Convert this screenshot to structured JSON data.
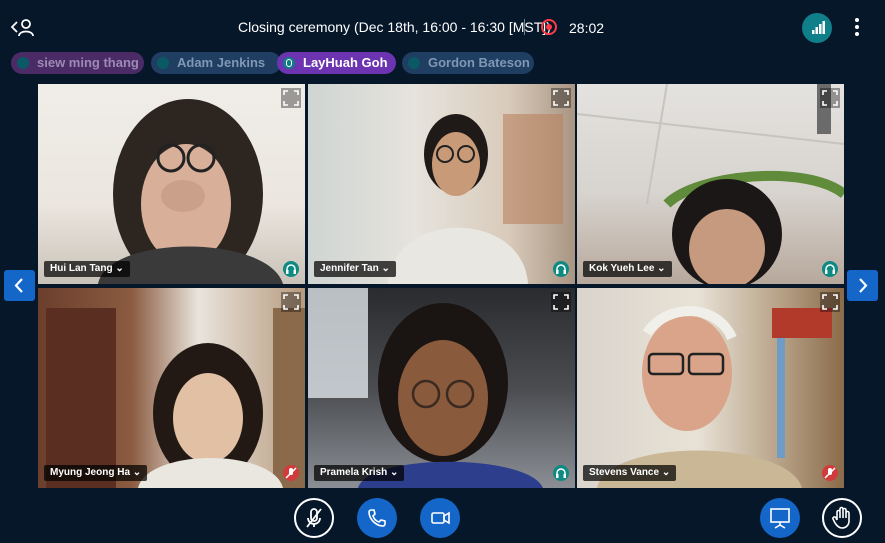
{
  "meeting": {
    "title": "Closing ceremony (Dec 18th, 16:00 - 16:30 [MST])",
    "recording_time": "28:02"
  },
  "participants_bar": [
    {
      "name": "siew ming thang"
    },
    {
      "name": "Adam Jenkins"
    },
    {
      "name": "LayHuah Goh"
    },
    {
      "name": "Gordon Bateson"
    }
  ],
  "video_tiles": [
    {
      "name": "Hui Lan Tang",
      "audio": "listen-only"
    },
    {
      "name": "Jennifer Tan",
      "audio": "listen-only"
    },
    {
      "name": "Kok Yueh Lee",
      "audio": "listen-only"
    },
    {
      "name": "Myung Jeong Ha",
      "audio": "muted"
    },
    {
      "name": "Pramela Krish",
      "audio": "listen-only"
    },
    {
      "name": "Stevens Vance",
      "audio": "muted"
    }
  ],
  "colors": {
    "background": "#06172a",
    "accent_blue": "#1467c9",
    "talking_purple": "#6c34b0",
    "record_red": "#ff3b45",
    "listen_teal": "#0f8a83",
    "muted_red": "#d23b3b"
  },
  "icons": {
    "back": "user-back-icon",
    "record": "record-icon",
    "signal": "connection-signal-icon",
    "more": "vertical-dots-icon",
    "expand": "fullscreen-icon",
    "listen": "headphones-icon",
    "muted": "mic-muted-icon",
    "mic": "microphone-icon",
    "phone": "phone-icon",
    "video": "video-camera-icon",
    "present": "presentation-icon",
    "hand": "raise-hand-icon"
  }
}
